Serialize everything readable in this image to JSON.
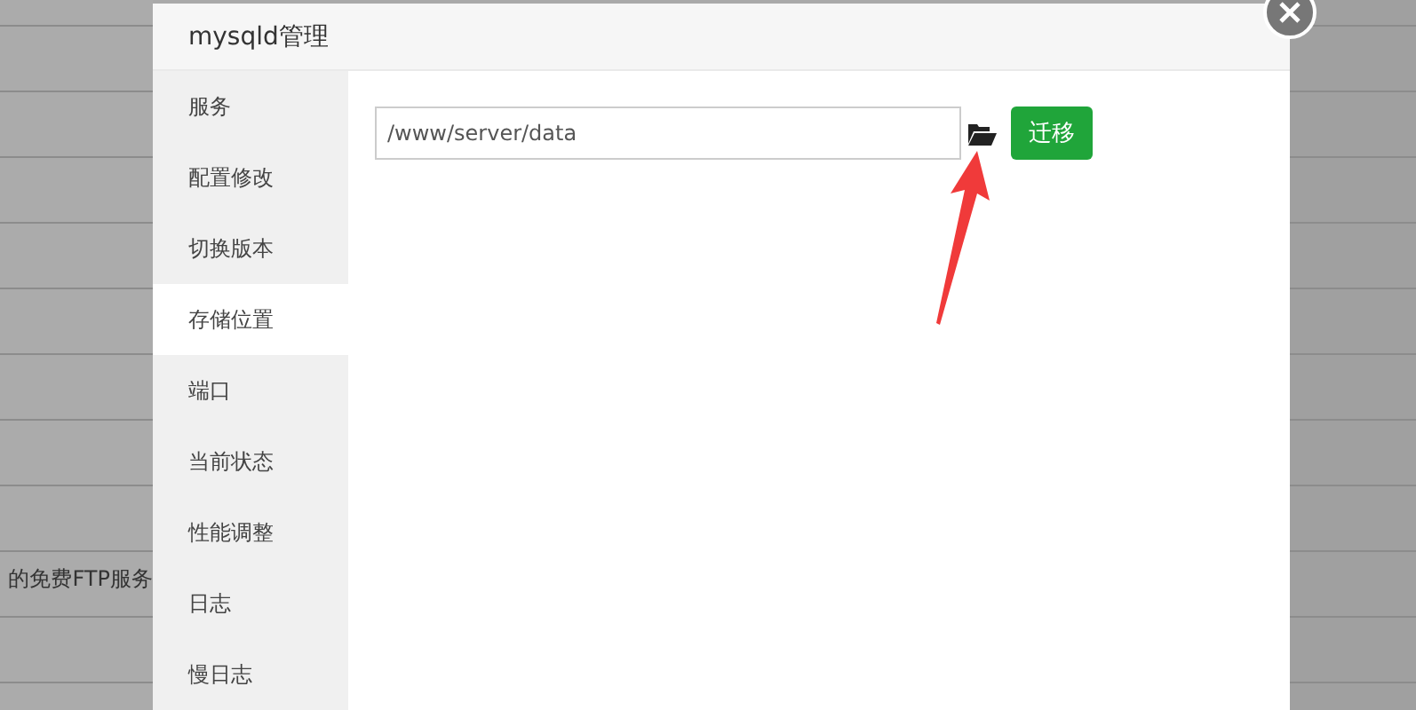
{
  "background": {
    "text": "的免费FTP服务"
  },
  "dialog": {
    "title": "mysqld管理",
    "sidebar": {
      "items": [
        {
          "label": "服务",
          "selected": false
        },
        {
          "label": "配置修改",
          "selected": false
        },
        {
          "label": "切换版本",
          "selected": false
        },
        {
          "label": "存储位置",
          "selected": true
        },
        {
          "label": "端口",
          "selected": false
        },
        {
          "label": "当前状态",
          "selected": false
        },
        {
          "label": "性能调整",
          "selected": false
        },
        {
          "label": "日志",
          "selected": false
        },
        {
          "label": "慢日志",
          "selected": false
        }
      ]
    },
    "path_field": {
      "value": "/www/server/data"
    },
    "button": "迁移"
  }
}
